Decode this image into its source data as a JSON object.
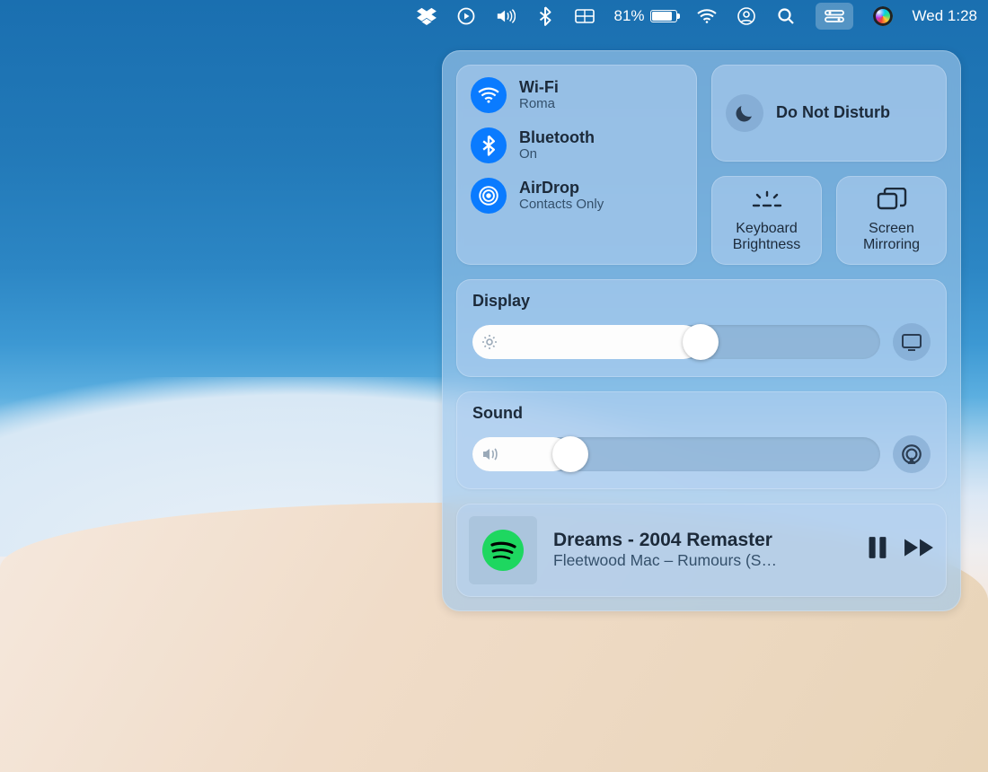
{
  "menubar": {
    "battery_percent": "81%",
    "battery_level": 0.81,
    "clock": "Wed 1:28"
  },
  "control_center": {
    "connectivity": {
      "wifi": {
        "title": "Wi-Fi",
        "subtitle": "Roma"
      },
      "bluetooth": {
        "title": "Bluetooth",
        "subtitle": "On"
      },
      "airdrop": {
        "title": "AirDrop",
        "subtitle": "Contacts Only"
      }
    },
    "dnd": {
      "title": "Do Not Disturb"
    },
    "keyboard_brightness": {
      "label": "Keyboard Brightness"
    },
    "screen_mirroring": {
      "label": "Screen Mirroring"
    },
    "display": {
      "title": "Display",
      "level": 0.56
    },
    "sound": {
      "title": "Sound",
      "level": 0.24
    },
    "media": {
      "title": "Dreams - 2004 Remaster",
      "subtitle": "Fleetwood Mac – Rumours (S…"
    }
  }
}
